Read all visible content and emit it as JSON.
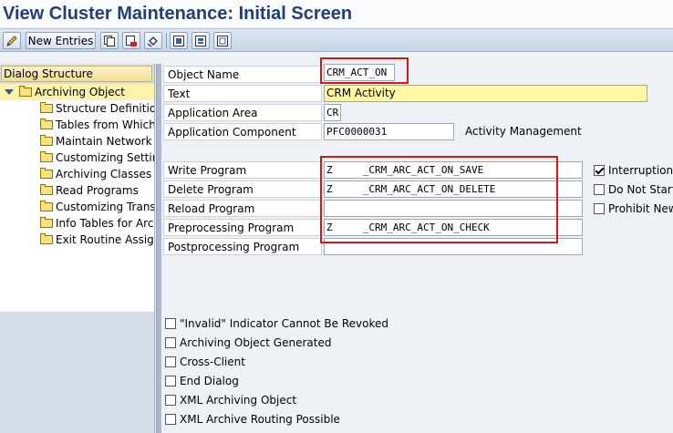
{
  "window": {
    "title": "View Cluster Maintenance: Initial Screen"
  },
  "toolbar": {
    "new_entries_label": "New Entries",
    "icons": [
      "change-display-icon",
      "copy-icon",
      "delete-icon",
      "undo-icon",
      "select-all-icon",
      "select-block-icon",
      "deselect-all-icon"
    ]
  },
  "dialog_structure": {
    "header": "Dialog Structure",
    "root_label": "Archiving Object",
    "items": [
      "Structure Definition",
      "Tables from Which",
      "Maintain Network G",
      "Customizing Setting",
      "Archiving Classes U",
      "Read Programs",
      "Customizing Transa",
      "Info Tables for Archi",
      "Exit Routine Assign"
    ]
  },
  "form": {
    "object_name_label": "Object Name",
    "object_name_value": "CRM_ACT_ON",
    "text_label": "Text",
    "text_value": "CRM Activity",
    "app_area_label": "Application Area",
    "app_area_value": "CR",
    "app_component_label": "Application Component",
    "app_component_value": "PFC0000031",
    "app_component_desc": "Activity Management",
    "write_program_label": "Write Program",
    "write_program_value": "Z     _CRM_ARC_ACT_ON_SAVE",
    "delete_program_label": "Delete Program",
    "delete_program_value": "Z     _CRM_ARC_ACT_ON_DELETE",
    "reload_program_label": "Reload Program",
    "reload_program_value": "",
    "preprocessing_label": "Preprocessing Program",
    "preprocessing_value": "Z     _CRM_ARC_ACT_ON_CHECK",
    "postprocessing_label": "Postprocessing Program",
    "postprocessing_value": ""
  },
  "right_options": [
    {
      "label": "Interruption P",
      "checked": true
    },
    {
      "label": "Do Not Start B",
      "checked": false
    },
    {
      "label": "Prohibit New",
      "checked": false
    }
  ],
  "bottom_options": [
    {
      "label": "\"Invalid\" Indicator Cannot Be Revoked",
      "checked": false
    },
    {
      "label": "Archiving Object Generated",
      "checked": false
    },
    {
      "label": "Cross-Client",
      "checked": false
    },
    {
      "label": "End Dialog",
      "checked": false
    },
    {
      "label": "XML Archiving Object",
      "checked": false
    },
    {
      "label": "XML Archive Routing Possible",
      "checked": false
    }
  ],
  "colors": {
    "title": "#1f3f7a",
    "highlight_box": "#d01919",
    "selected_row": "#fbf3a8"
  }
}
